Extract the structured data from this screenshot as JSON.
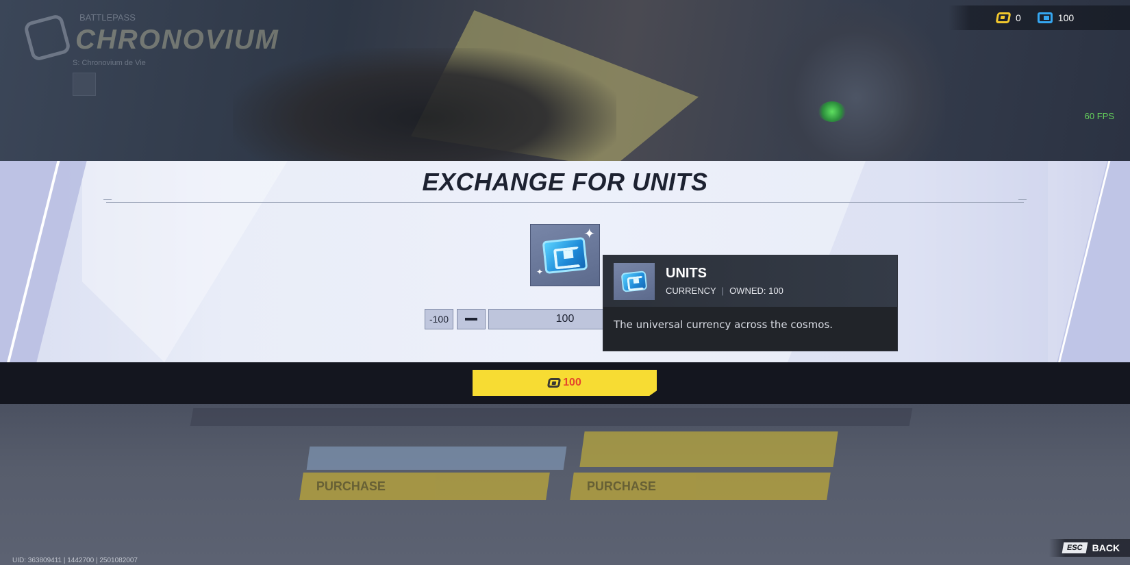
{
  "hud": {
    "logo_sub": "BATTLEPASS",
    "logo_title": "CHRONOVIUM",
    "logo_caption": "S: Chronovium de Vie",
    "currencies": [
      {
        "name": "chronotokens",
        "amount": "0",
        "icon": "chrono-token-icon",
        "color": "#f1c72d"
      },
      {
        "name": "units",
        "amount": "100",
        "icon": "units-icon",
        "color": "#35a6f0"
      }
    ],
    "fps": "60 FPS"
  },
  "background": {
    "purchase_labels": [
      "PURCHASE",
      "PURCHASE"
    ]
  },
  "dialog": {
    "title": "EXCHANGE FOR UNITS",
    "item_icon": "units-gem-icon",
    "quantity": {
      "minus_100_label": "-100",
      "minus_1_icon": "minus-icon",
      "value": "100"
    },
    "purchase": {
      "price": "100",
      "icon": "chrono-token-icon",
      "button_color": "#f7dc33",
      "price_color": "#e4462c"
    }
  },
  "tooltip": {
    "name": "UNITS",
    "category": "CURRENCY",
    "separator": "|",
    "owned": "OWNED: 100",
    "description": "The universal currency across the cosmos."
  },
  "footer": {
    "uid": "UID: 363809411 | 1442700 | 2501082007",
    "back_key": "ESC",
    "back_label": "BACK"
  }
}
